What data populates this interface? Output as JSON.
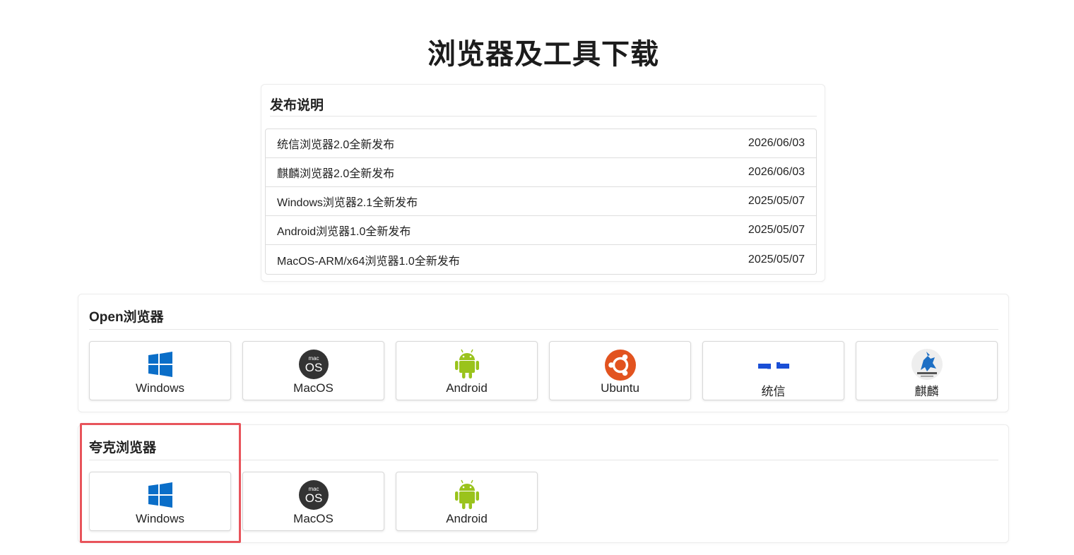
{
  "page": {
    "title": "浏览器及工具下载"
  },
  "release": {
    "heading": "发布说明",
    "items": [
      {
        "title": "统信浏览器2.0全新发布",
        "date": "2026/06/03"
      },
      {
        "title": "麒麟浏览器2.0全新发布",
        "date": "2026/06/03"
      },
      {
        "title": "Windows浏览器2.1全新发布",
        "date": "2025/05/07"
      },
      {
        "title": "Android浏览器1.0全新发布",
        "date": "2025/05/07"
      },
      {
        "title": "MacOS-ARM/x64浏览器1.0全新发布",
        "date": "2025/05/07"
      }
    ]
  },
  "open_browser": {
    "heading": "Open浏览器",
    "platforms": [
      {
        "label": "Windows",
        "icon": "windows-icon"
      },
      {
        "label": "MacOS",
        "icon": "macos-icon"
      },
      {
        "label": "Android",
        "icon": "android-icon"
      },
      {
        "label": "Ubuntu",
        "icon": "ubuntu-icon"
      },
      {
        "label": "统信",
        "icon": "uos-icon"
      },
      {
        "label": "麒麟",
        "icon": "kylin-icon"
      }
    ]
  },
  "quark_browser": {
    "heading": "夸克浏览器",
    "platforms": [
      {
        "label": "Windows",
        "icon": "windows-icon"
      },
      {
        "label": "MacOS",
        "icon": "macos-icon"
      },
      {
        "label": "Android",
        "icon": "android-icon"
      }
    ]
  },
  "icon_text": {
    "macos_small": "mac",
    "macos_big": "OS"
  },
  "colors": {
    "windows_blue": "#0a6ec8",
    "macos_dark": "#333333",
    "android_green": "#9ac31c",
    "ubuntu_orange": "#e2531f",
    "uos_blue": "#1a4fd6",
    "kylin_blue": "#1d6fc4",
    "highlight_red": "#e8545b"
  }
}
